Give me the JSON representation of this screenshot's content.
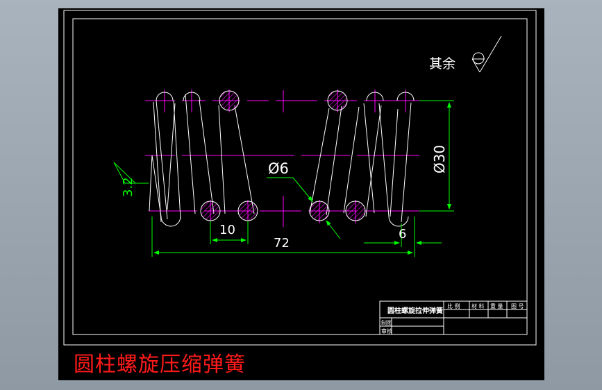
{
  "caption": "圆柱螺旋压缩弹簧",
  "roughness": {
    "label": "其余"
  },
  "roughness_value": "3.2",
  "dimensions": {
    "wire_diameter": "Ø6",
    "outer_diameter": "Ø30",
    "pitch": "10",
    "length": "72",
    "end": "6"
  },
  "title_block": {
    "name": "圆柱螺旋拉伸弹簧",
    "headers": [
      "比 例",
      "材 料",
      "重 量",
      "图 号"
    ],
    "designed": "制图",
    "checked": "审核"
  },
  "colors": {
    "outline": "#ffffff",
    "centerline": "#ff00ff",
    "dimension": "#00ff00",
    "caption": "#ff1a1a",
    "background": "#000000"
  }
}
